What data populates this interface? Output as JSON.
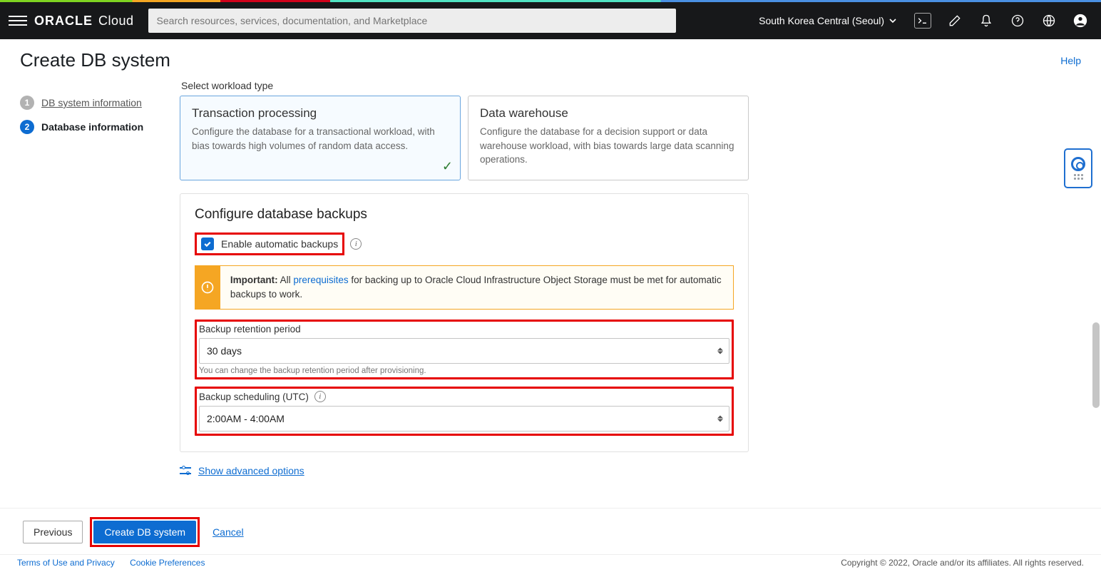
{
  "header": {
    "search_placeholder": "Search resources, services, documentation, and Marketplace",
    "region": "South Korea Central (Seoul)",
    "logo_brand": "ORACLE",
    "logo_sub": "Cloud"
  },
  "page": {
    "title": "Create DB system",
    "help": "Help"
  },
  "steps": {
    "s1": {
      "num": "1",
      "label": "DB system information"
    },
    "s2": {
      "num": "2",
      "label": "Database information"
    }
  },
  "workload": {
    "section_label": "Select workload type",
    "tp": {
      "title": "Transaction processing",
      "desc": "Configure the database for a transactional workload, with bias towards high volumes of random data access."
    },
    "dw": {
      "title": "Data warehouse",
      "desc": "Configure the database for a decision support or data warehouse workload, with bias towards large data scanning operations."
    }
  },
  "backups": {
    "heading": "Configure database backups",
    "enable_label": "Enable automatic backups",
    "alert_strong": "Important:",
    "alert_pre": " All ",
    "alert_link": "prerequisites",
    "alert_post": " for backing up to Oracle Cloud Infrastructure Object Storage must be met for automatic backups to work.",
    "retention_label": "Backup retention period",
    "retention_value": "30 days",
    "retention_help": "You can change the backup retention period after provisioning.",
    "schedule_label": "Backup scheduling (UTC)",
    "schedule_value": "2:00AM - 4:00AM"
  },
  "advanced": {
    "label": "Show advanced options"
  },
  "actions": {
    "previous": "Previous",
    "create": "Create DB system",
    "cancel": "Cancel"
  },
  "legal": {
    "terms": "Terms of Use and Privacy",
    "cookies": "Cookie Preferences",
    "copyright": "Copyright © 2022, Oracle and/or its affiliates. All rights reserved."
  }
}
